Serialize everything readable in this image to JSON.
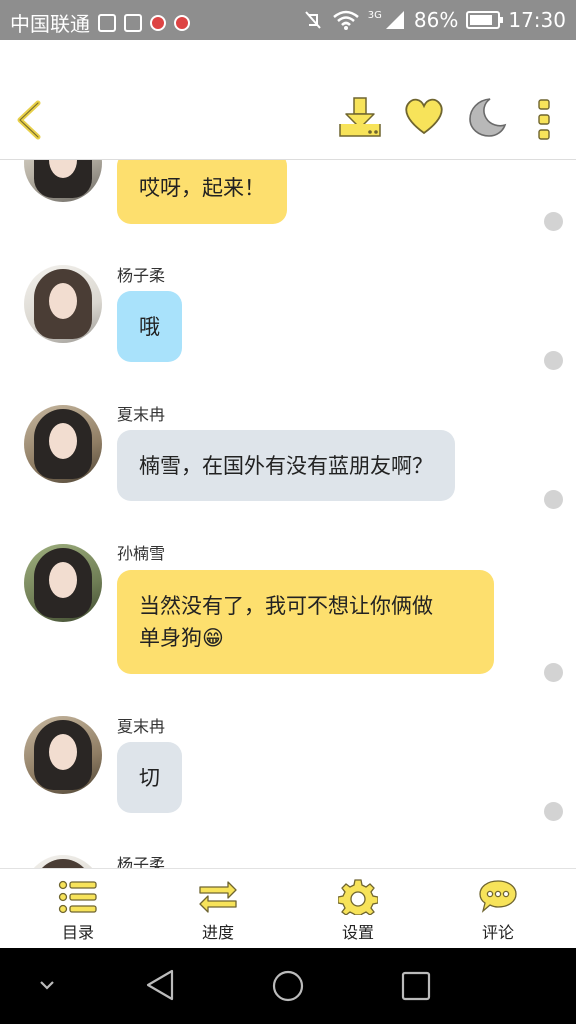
{
  "status_bar": {
    "carrier": "中国联通",
    "network": "3G",
    "battery": "86%",
    "battery_level": 0.86,
    "time": "17:30"
  },
  "toolbar": {
    "back_icon": "chevron-left-icon",
    "download_icon": "download-icon",
    "favorite_icon": "heart-icon",
    "night_mode_icon": "moon-icon",
    "more_icon": "more-vertical-icon",
    "accent_color": "#f7e35a"
  },
  "messages": [
    {
      "sender": "",
      "text": "哎呀，起来！",
      "bubble_color": "#fddf6e"
    },
    {
      "sender": "杨子柔",
      "text": "哦",
      "bubble_color": "#a9e2fb"
    },
    {
      "sender": "夏末冉",
      "text": "楠雪，在国外有没有蓝朋友啊？",
      "bubble_color": "#dee4ea"
    },
    {
      "sender": "孙楠雪",
      "text_line1": "当然没有了，我可不想让你俩做",
      "text_line2": "单身狗😁",
      "bubble_color": "#fddf6e"
    },
    {
      "sender": "夏末冉",
      "text": "切",
      "bubble_color": "#dee4ea"
    },
    {
      "sender": "杨子柔",
      "text": ""
    }
  ],
  "tabs": [
    {
      "label": "目录",
      "icon": "list-icon"
    },
    {
      "label": "进度",
      "icon": "swap-arrows-icon"
    },
    {
      "label": "设置",
      "icon": "gear-icon"
    },
    {
      "label": "评论",
      "icon": "comment-icon"
    }
  ],
  "nav_bar": {
    "icons": [
      "collapse-icon",
      "back-triangle-icon",
      "home-circle-icon",
      "recents-square-icon"
    ]
  }
}
